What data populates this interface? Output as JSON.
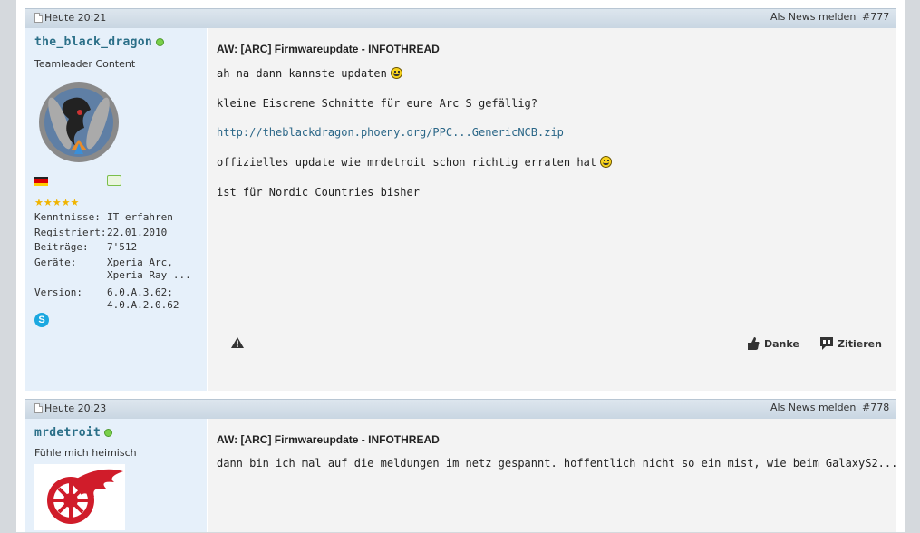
{
  "posts": [
    {
      "date": "Heute 20:21",
      "news_link": "Als News melden",
      "number": "#777",
      "user": {
        "name": "the_black_dragon",
        "title": "Teamleader Content",
        "info": [
          {
            "key": "Kenntnisse:",
            "value": "IT erfahren"
          },
          {
            "key": "Registriert:",
            "value": "22.01.2010"
          },
          {
            "key": "Beiträge:",
            "value": "7'512"
          },
          {
            "key": "Geräte:",
            "value": "Xperia Arc,\nXperia Ray ..."
          },
          {
            "key": "Version:",
            "value": "6.0.A.3.62;\n4.0.A.2.0.62"
          }
        ],
        "stars": 5
      },
      "title": "AW: [ARC] Firmwareupdate - INFOTHREAD",
      "lines": [
        "ah na dann kannste updaten",
        "kleine Eiscreme Schnitte für eure Arc S gefällig?",
        "http://theblackdragon.phoeny.org/PPC...GenericNCB.zip",
        "offizielles update wie mrdetroit schon richtig erraten hat",
        "ist für Nordic Countries bisher"
      ],
      "actions": {
        "thanks": "Danke",
        "quote": "Zitieren"
      }
    },
    {
      "date": "Heute 20:23",
      "news_link": "Als News melden",
      "number": "#778",
      "user": {
        "name": "mrdetroit",
        "title": "Fühle mich heimisch"
      },
      "title": "AW: [ARC] Firmwareupdate - INFOTHREAD",
      "lines": [
        "dann bin ich mal auf die meldungen im netz gespannt. hoffentlich nicht so ein mist, wie beim GalaxyS2..."
      ]
    }
  ],
  "colors": {
    "accent": "#2b6f88",
    "link": "#2a6687",
    "online": "#7ad04a"
  }
}
